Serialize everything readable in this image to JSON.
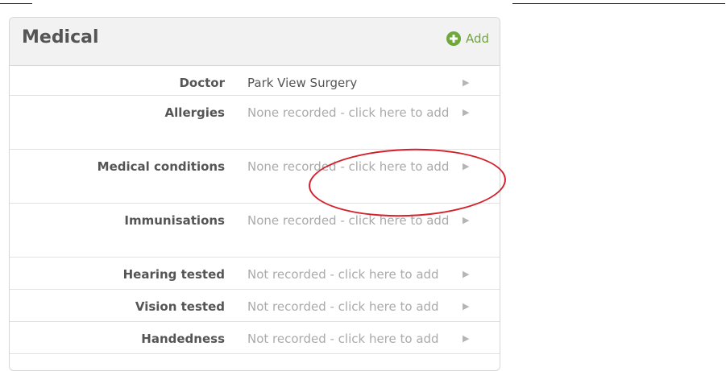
{
  "panel": {
    "title": "Medical",
    "add_label": "Add"
  },
  "rows": [
    {
      "label": "Doctor",
      "value": "Park View Surgery",
      "filled": true
    },
    {
      "label": "Allergies",
      "value": "None recorded - click here to add",
      "filled": false
    },
    {
      "label": "Medical conditions",
      "value": "None recorded - click here to add",
      "filled": false
    },
    {
      "label": "Immunisations",
      "value": "None recorded - click here to add",
      "filled": false
    },
    {
      "label": "Hearing tested",
      "value": "Not recorded - click here to add",
      "filled": false
    },
    {
      "label": "Vision tested",
      "value": "Not recorded - click here to add",
      "filled": false
    },
    {
      "label": "Handedness",
      "value": "Not recorded - click here to add",
      "filled": false
    }
  ],
  "icons": {
    "add": "plus-circle-icon",
    "row_arrow": "triangle-right-icon"
  },
  "colors": {
    "accent_green": "#6ea83a",
    "annotation_red": "#d4202a"
  }
}
